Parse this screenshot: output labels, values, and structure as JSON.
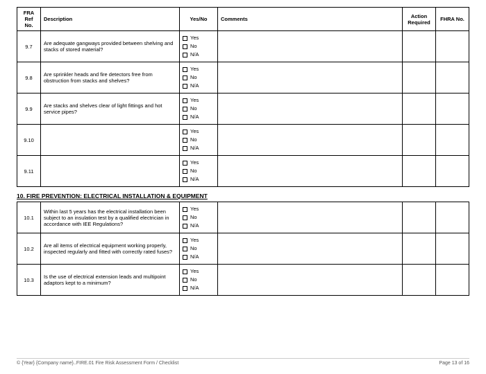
{
  "headers": {
    "ref": "FRA Ref No.",
    "desc": "Description",
    "yn": "Yes/No",
    "comments": "Comments",
    "action": "Action Required",
    "fhra": "FHRA No."
  },
  "yn_labels": {
    "yes": "Yes",
    "no": "No",
    "na": "N/A"
  },
  "rows1": [
    {
      "ref": "9.7",
      "desc": "Are adequate gangways provided between shelving and stacks of stored material?"
    },
    {
      "ref": "9.8",
      "desc": "Are sprinkler heads and fire detectors free from obstruction from stacks and shelves?"
    },
    {
      "ref": "9.9",
      "desc": "Are stacks and shelves clear of light fittings and hot service pipes?"
    },
    {
      "ref": "9.10",
      "desc": ""
    },
    {
      "ref": "9.11",
      "desc": ""
    }
  ],
  "section2_title": "10. FIRE PREVENTION: ELECTRICAL INSTALLATION & EQUIPMENT",
  "rows2": [
    {
      "ref": "10.1",
      "desc": "Within last 5 years has the electrical installation been subject to an insulation test by a qualified electrician in accordance with IEE Regulations?"
    },
    {
      "ref": "10.2",
      "desc": "Are all items of electrical equipment working properly, inspected regularly and fitted with correctly rated fuses?"
    },
    {
      "ref": "10.3",
      "desc": "Is the use of electrical extension leads and multipoint adaptors kept to a minimum?"
    }
  ],
  "footer": {
    "left": "© {Year} {Company name}..FIRE.01 Fire Risk Assessment Form / Checklist",
    "right": "Page 13 of 16"
  }
}
